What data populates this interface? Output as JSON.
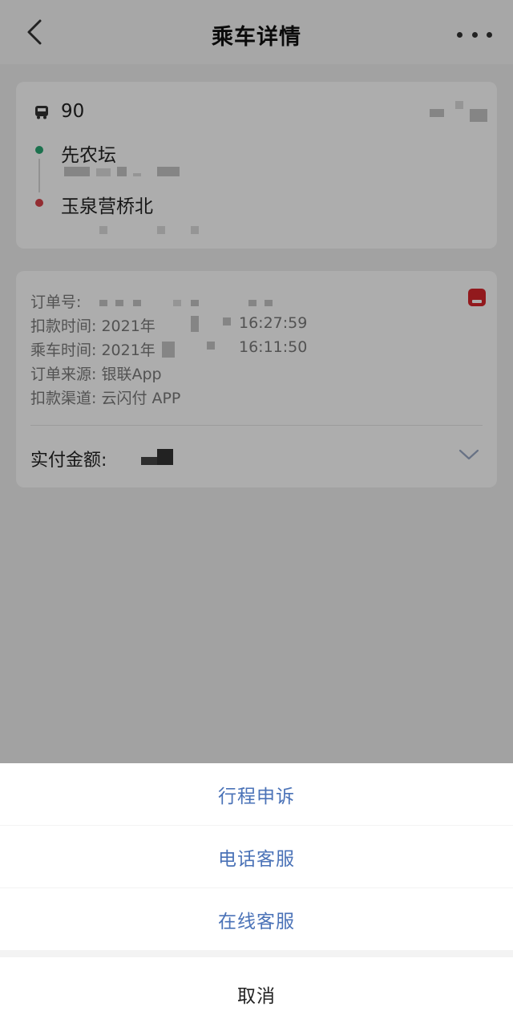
{
  "header": {
    "title": "乘车详情",
    "back_icon": "chevron-left-icon",
    "more_icon": "more-dots-icon"
  },
  "trip": {
    "route_number": "90",
    "start_station": "先农坛",
    "end_station": "玉泉营桥北",
    "colors": {
      "start": "#2aa774",
      "end": "#d9434b"
    }
  },
  "order": {
    "order_no_label": "订单号:",
    "deduct_time_label": "扣款时间: 2021年",
    "deduct_time_value": "16:27:59",
    "ride_time_label": "乘车时间: 2021年",
    "ride_time_value": "16:11:50",
    "source": "订单来源: 银联App",
    "channel": "扣款渠道: 云闪付 APP",
    "paid_label": "实付金额:"
  },
  "action_sheet": {
    "items": [
      "行程申诉",
      "电话客服",
      "在线客服"
    ],
    "cancel": "取消",
    "item_color": "#4a72b7"
  }
}
